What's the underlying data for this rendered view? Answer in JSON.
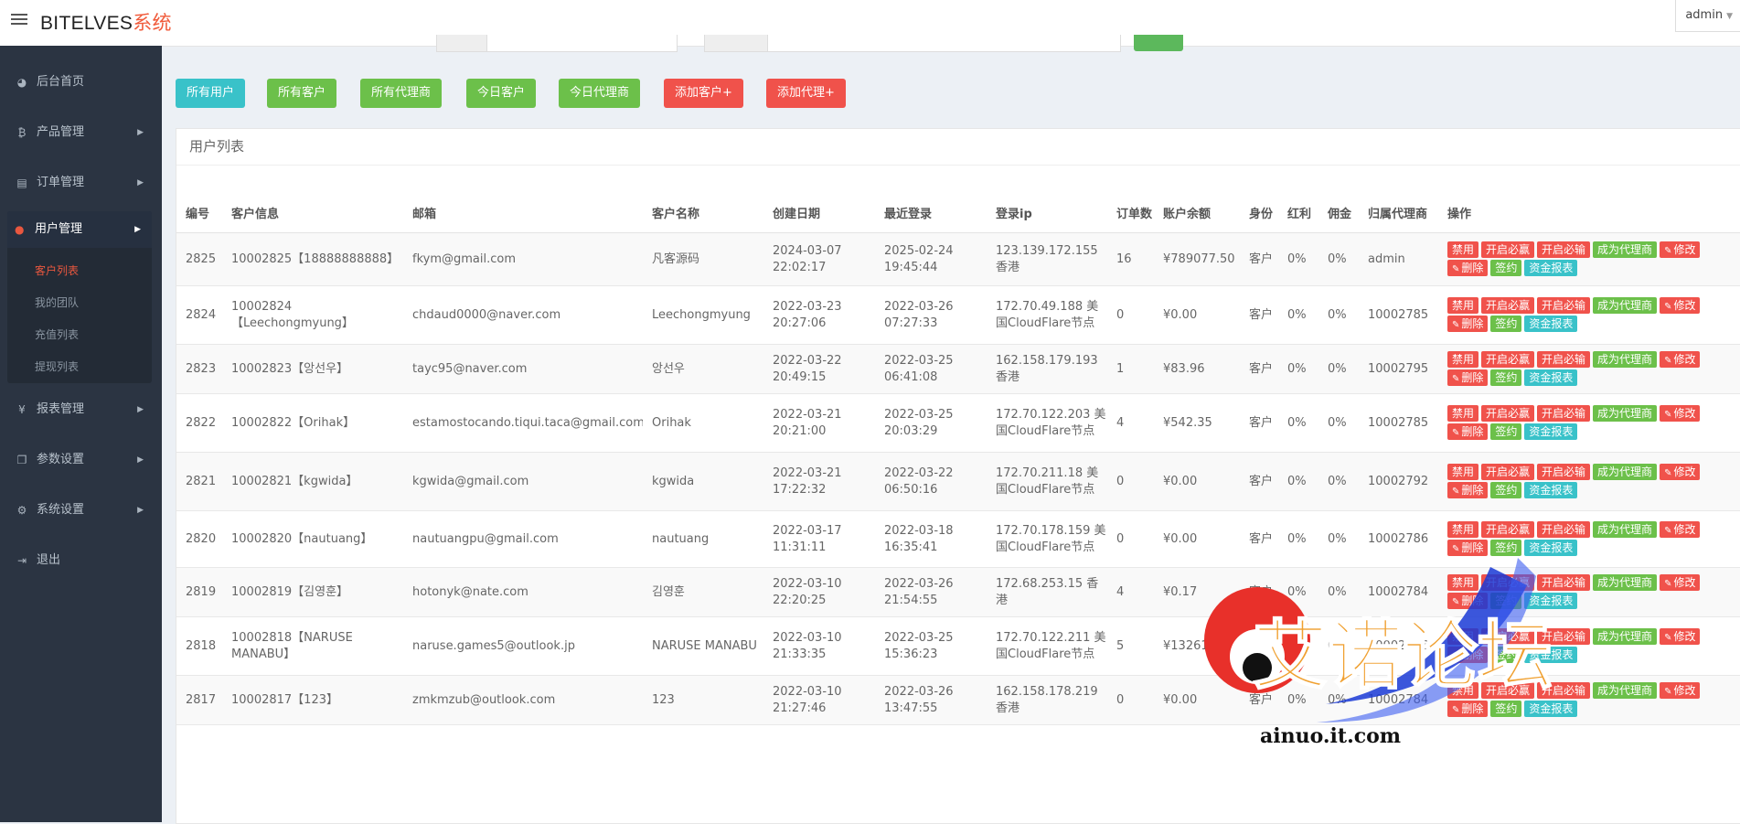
{
  "header": {
    "brand": "BITELVES",
    "brand_suffix": "系统",
    "user": "admin"
  },
  "sidebar": {
    "items": [
      {
        "label": "后台首页",
        "icon": "dashboard-icon"
      },
      {
        "label": "产品管理",
        "icon": "bitcoin-icon"
      },
      {
        "label": "订单管理",
        "icon": "document-icon"
      },
      {
        "label": "用户管理",
        "icon": "user-icon"
      },
      {
        "label": "报表管理",
        "icon": "yen-icon"
      },
      {
        "label": "参数设置",
        "icon": "copy-icon"
      },
      {
        "label": "系统设置",
        "icon": "gears-icon"
      },
      {
        "label": "退出",
        "icon": "logout-icon"
      }
    ],
    "sub_items": [
      "客户列表",
      "我的团队",
      "充值列表",
      "提现列表"
    ]
  },
  "actions": [
    "所有用户",
    "所有客户",
    "所有代理商",
    "今日客户",
    "今日代理商",
    "添加客户+",
    "添加代理+"
  ],
  "panel_title": "用户列表",
  "columns": [
    "编号",
    "客户信息",
    "邮箱",
    "客户名称",
    "创建日期",
    "最近登录",
    "登录ip",
    "订单数",
    "账户余额",
    "身份",
    "红利",
    "佣金",
    "归属代理商",
    "操作"
  ],
  "op_buttons": [
    "禁用",
    "开启必赢",
    "开启必输",
    "成为代理商",
    "修改",
    "删除",
    "签约",
    "资金报表"
  ],
  "rows": [
    {
      "id": "2825",
      "info": "10002825【18888888888】",
      "email": "fkym@gmail.com",
      "name": "凡客源码",
      "created": "2024-03-07 22:02:17",
      "last_login": "2025-02-24 19:45:44",
      "ip": "123.139.172.155 香港",
      "orders": "16",
      "balance": "¥789077.50",
      "role": "客户",
      "bonus": "0%",
      "commission": "0%",
      "agent": "admin"
    },
    {
      "id": "2824",
      "info": "10002824【Leechongmyung】",
      "email": "chdaud0000@naver.com",
      "name": "Leechongmyung",
      "created": "2022-03-23 20:27:06",
      "last_login": "2022-03-26 07:27:33",
      "ip": "172.70.49.188 美国CloudFlare节点",
      "orders": "0",
      "balance": "¥0.00",
      "role": "客户",
      "bonus": "0%",
      "commission": "0%",
      "agent": "10002785"
    },
    {
      "id": "2823",
      "info": "10002823【앙선우】",
      "email": "tayc95@naver.com",
      "name": "앙선우",
      "created": "2022-03-22 20:49:15",
      "last_login": "2022-03-25 06:41:08",
      "ip": "162.158.179.193 香港",
      "orders": "1",
      "balance": "¥83.96",
      "role": "客户",
      "bonus": "0%",
      "commission": "0%",
      "agent": "10002795"
    },
    {
      "id": "2822",
      "info": "10002822【Orihak】",
      "email": "estamostocando.tiqui.taca@gmail.com",
      "name": "Orihak",
      "created": "2022-03-21 20:21:00",
      "last_login": "2022-03-25 20:03:29",
      "ip": "172.70.122.203 美国CloudFlare节点",
      "orders": "4",
      "balance": "¥542.35",
      "role": "客户",
      "bonus": "0%",
      "commission": "0%",
      "agent": "10002785"
    },
    {
      "id": "2821",
      "info": "10002821【kgwida】",
      "email": "kgwida@gmail.com",
      "name": "kgwida",
      "created": "2022-03-21 17:22:32",
      "last_login": "2022-03-22 06:50:16",
      "ip": "172.70.211.18 美国CloudFlare节点",
      "orders": "0",
      "balance": "¥0.00",
      "role": "客户",
      "bonus": "0%",
      "commission": "0%",
      "agent": "10002792"
    },
    {
      "id": "2820",
      "info": "10002820【nautuang】",
      "email": "nautuangpu@gmail.com",
      "name": "nautuang",
      "created": "2022-03-17 11:31:11",
      "last_login": "2022-03-18 16:35:41",
      "ip": "172.70.178.159 美国CloudFlare节点",
      "orders": "0",
      "balance": "¥0.00",
      "role": "客户",
      "bonus": "0%",
      "commission": "0%",
      "agent": "10002786"
    },
    {
      "id": "2819",
      "info": "10002819【김영훈】",
      "email": "hotonyk@nate.com",
      "name": "김영훈",
      "created": "2022-03-10 22:20:25",
      "last_login": "2022-03-26 21:54:55",
      "ip": "172.68.253.15 香港",
      "orders": "4",
      "balance": "¥0.17",
      "role": "客户",
      "bonus": "0%",
      "commission": "0%",
      "agent": "10002784"
    },
    {
      "id": "2818",
      "info": "10002818【NARUSE MANABU】",
      "email": "naruse.games5@outlook.jp",
      "name": "NARUSE MANABU",
      "created": "2022-03-10 21:33:35",
      "last_login": "2022-03-25 15:36:23",
      "ip": "172.70.122.211 美国CloudFlare节点",
      "orders": "5",
      "balance": "¥13261.87",
      "role": "客户",
      "bonus": "0%",
      "commission": "0%",
      "agent": "10002786"
    },
    {
      "id": "2817",
      "info": "10002817【123】",
      "email": "zmkmzub@outlook.com",
      "name": "123",
      "created": "2022-03-10 21:27:46",
      "last_login": "2022-03-26 13:47:55",
      "ip": "162.158.178.219 香港",
      "orders": "0",
      "balance": "¥0.00",
      "role": "客户",
      "bonus": "0%",
      "commission": "0%",
      "agent": "10002784"
    }
  ],
  "watermark": {
    "text": "艾诺论坛",
    "domain": "ainuo.it.com"
  }
}
